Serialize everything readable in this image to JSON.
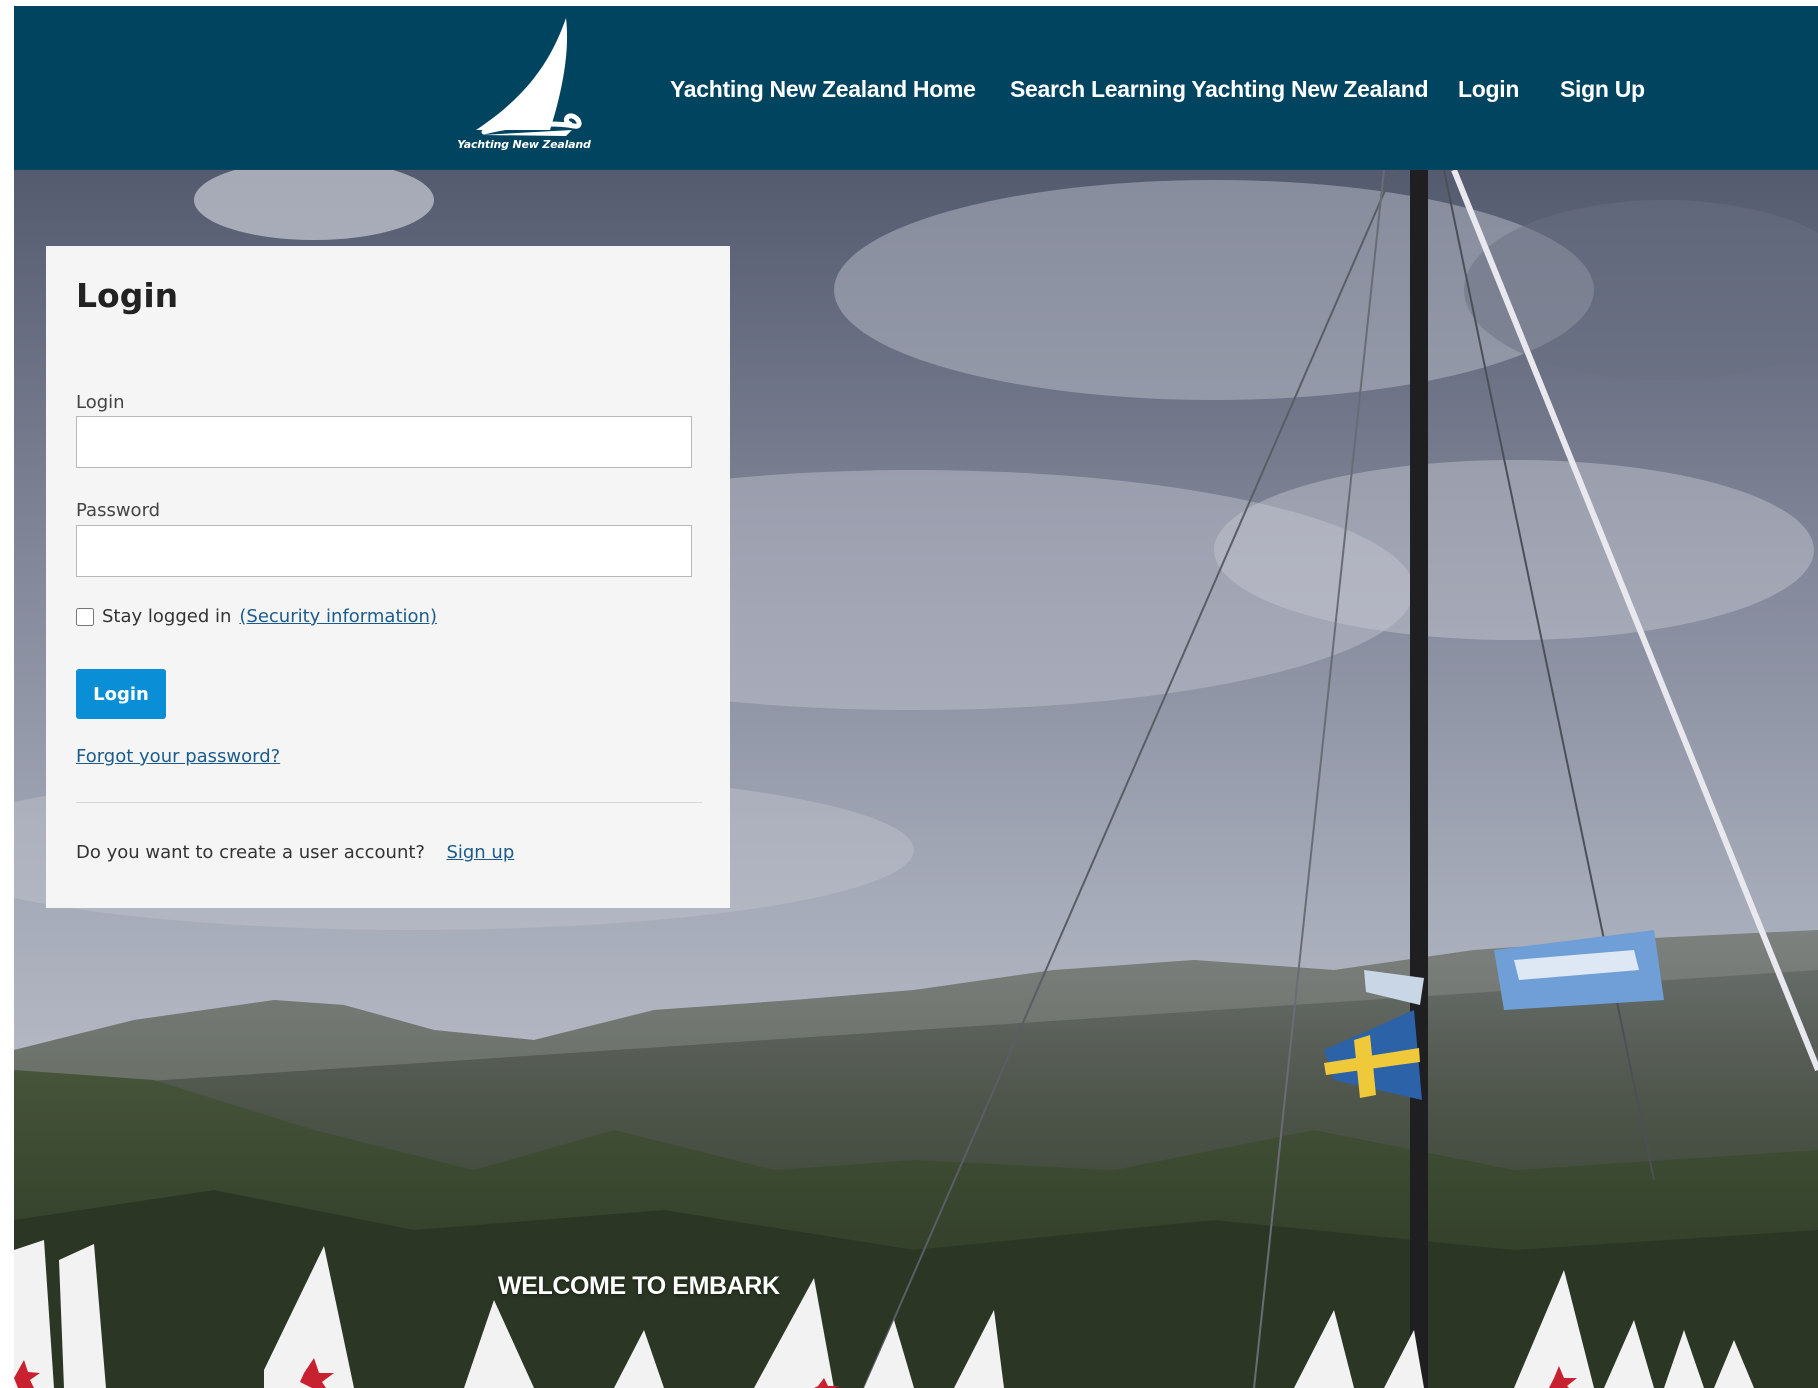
{
  "colors": {
    "brand": "#01445f",
    "accent": "#0a8fd6",
    "link": "#1c5c8c"
  },
  "header": {
    "logo_icon": "sailboat-logo",
    "logo_text": "Yachting New Zealand",
    "nav": [
      {
        "label": "Yachting New Zealand Home"
      },
      {
        "label": "Search Learning Yachting New Zealand"
      },
      {
        "label": "Login"
      },
      {
        "label": "Sign Up"
      }
    ]
  },
  "login": {
    "title": "Login",
    "username_label": "Login",
    "username_value": "",
    "password_label": "Password",
    "password_value": "",
    "stay_logged_in_label": "Stay logged in",
    "stay_logged_in_checked": false,
    "security_link": "(Security information)",
    "submit_label": "Login",
    "forgot_link": "Forgot your password?",
    "create_account_prompt": "Do you want to create a user account?",
    "signup_link": "Sign up"
  },
  "hero": {
    "welcome_text": "WELCOME TO EMBARK"
  }
}
